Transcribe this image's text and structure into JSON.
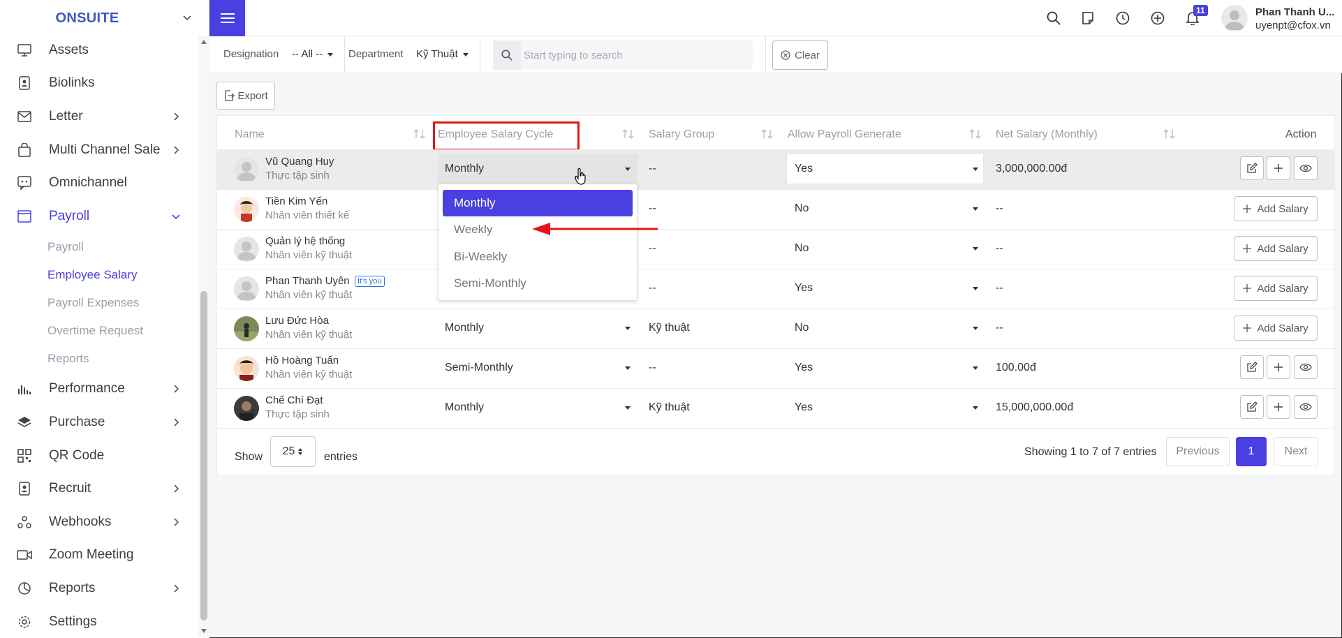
{
  "brand": {
    "name": "ONSUITE"
  },
  "sidebar": {
    "items": [
      {
        "label": "Assets",
        "icon": "monitor-icon",
        "chevron": false
      },
      {
        "label": "Biolinks",
        "icon": "badge-icon",
        "chevron": false
      },
      {
        "label": "Letter",
        "icon": "mail-icon",
        "chevron": true
      },
      {
        "label": "Multi Channel Sale",
        "icon": "bag-icon",
        "chevron": true
      },
      {
        "label": "Omnichannel",
        "icon": "chat-icon",
        "chevron": false
      },
      {
        "label": "Payroll",
        "icon": "window-icon",
        "chevron": true,
        "active": true,
        "expanded": true
      }
    ],
    "payroll_sub": [
      {
        "label": "Payroll"
      },
      {
        "label": "Employee Salary",
        "active": true
      },
      {
        "label": "Payroll Expenses"
      },
      {
        "label": "Overtime Request"
      },
      {
        "label": "Reports"
      }
    ],
    "items_after": [
      {
        "label": "Performance",
        "icon": "bar-chart-icon",
        "chevron": true
      },
      {
        "label": "Purchase",
        "icon": "layers-icon",
        "chevron": true
      },
      {
        "label": "QR Code",
        "icon": "qr-code-icon",
        "chevron": false
      },
      {
        "label": "Recruit",
        "icon": "badge-icon",
        "chevron": true
      },
      {
        "label": "Webhooks",
        "icon": "webhooks-icon",
        "chevron": true
      },
      {
        "label": "Zoom Meeting",
        "icon": "video-icon",
        "chevron": false
      },
      {
        "label": "Reports",
        "icon": "pie-chart-icon",
        "chevron": true
      },
      {
        "label": "Settings",
        "icon": "gear-icon",
        "chevron": false
      }
    ]
  },
  "topbar": {
    "notification_count": "11",
    "user_name": "Phan Thanh U...",
    "user_email": "uyenpt@cfox.vn"
  },
  "filters": {
    "designation_label": "Designation",
    "designation_value": "-- All --",
    "department_label": "Department",
    "department_value": "Kỹ Thuật",
    "search_placeholder": "Start typing to search",
    "clear_label": "Clear"
  },
  "toolbar": {
    "export_label": "Export"
  },
  "table": {
    "headers": {
      "name": "Name",
      "cycle": "Employee Salary Cycle",
      "group": "Salary Group",
      "allow": "Allow Payroll Generate",
      "net": "Net Salary (Monthly)",
      "action": "Action"
    },
    "rows": [
      {
        "name": "Vũ Quang Huy",
        "role": "Thực tập sinh",
        "cycle": "Monthly",
        "group": "--",
        "allow": "Yes",
        "net": "3,000,000.00đ",
        "action": "icons"
      },
      {
        "name": "Tiền Kim Yến",
        "role": "Nhân viên thiết kế",
        "cycle": "",
        "group": "--",
        "allow": "No",
        "net": "--",
        "action": "add"
      },
      {
        "name": "Quản lý hệ thống",
        "role": "Nhân viên kỹ thuật",
        "cycle": "",
        "group": "--",
        "allow": "No",
        "net": "--",
        "action": "add"
      },
      {
        "name": "Phan Thanh Uyên",
        "role": "Nhân viên kỹ thuật",
        "badge": "It's you",
        "cycle": "",
        "group": "--",
        "allow": "Yes",
        "net": "--",
        "action": "add"
      },
      {
        "name": "Lưu Đức Hòa",
        "role": "Nhân viên kỹ thuật",
        "cycle": "Monthly",
        "group": "Kỹ thuật",
        "allow": "No",
        "net": "--",
        "action": "add"
      },
      {
        "name": "Hồ Hoàng Tuấn",
        "role": "Nhân viên kỹ thuật",
        "cycle": "Semi-Monthly",
        "group": "--",
        "allow": "Yes",
        "net": "100.00đ",
        "action": "icons"
      },
      {
        "name": "Chế Chí Đạt",
        "role": "Thực tập sinh",
        "cycle": "Monthly",
        "group": "Kỹ thuật",
        "allow": "Yes",
        "net": "15,000,000.00đ",
        "action": "icons"
      }
    ],
    "add_salary_label": "Add Salary"
  },
  "dropdown": {
    "options": [
      "Monthly",
      "Weekly",
      "Bi-Weekly",
      "Semi-Monthly"
    ],
    "selected": "Monthly"
  },
  "footer": {
    "show_label": "Show",
    "page_length": "25",
    "entries_label": "entries",
    "info": "Showing 1 to 7 of 7 entries",
    "previous_label": "Previous",
    "current_page": "1",
    "next_label": "Next"
  },
  "colors": {
    "accent": "#4a3fe0",
    "brand": "#3f56c8",
    "highlight_red": "#e5141b"
  }
}
